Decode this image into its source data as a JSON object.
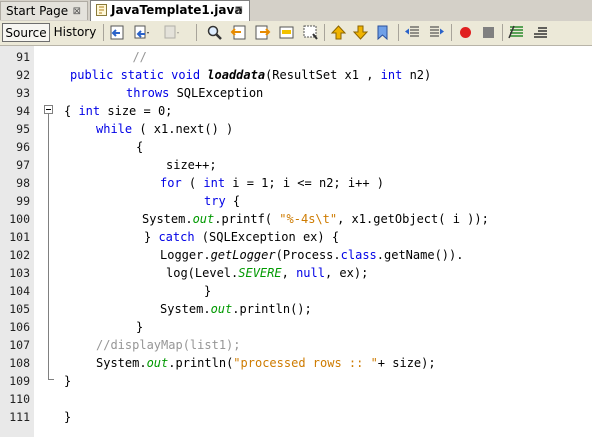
{
  "tabs": [
    {
      "label": "Start Page",
      "close": "⊠",
      "active": false
    },
    {
      "label": "JavaTemplate1.java",
      "close": "⊠",
      "active": true
    }
  ],
  "toolbar": {
    "source_label": "Source",
    "history_label": "History",
    "icons": [
      "last-edit-icon",
      "back-icon",
      "forward-icon",
      "find-icon",
      "find-previous-icon",
      "find-next-icon",
      "toggle-highlight-icon",
      "toggle-rect-select-icon",
      "previous-bookmark-icon",
      "next-bookmark-icon",
      "toggle-bookmark-icon",
      "shift-left-icon",
      "shift-right-icon",
      "start-macro-icon",
      "stop-macro-icon",
      "comment-icon",
      "uncomment-icon"
    ]
  },
  "editor": {
    "lines": [
      {
        "n": "91",
        "parts": [
          [
            "  //",
            "cmt"
          ]
        ]
      },
      {
        "n": "92",
        "parts": [
          [
            "public static void ",
            "kw"
          ],
          [
            "loaddata",
            "mth"
          ],
          [
            "(ResultSet x1 , ",
            ""
          ],
          [
            "int",
            "kw"
          ],
          [
            " n2)",
            ""
          ]
        ]
      },
      {
        "n": "93",
        "parts": [
          [
            "throws ",
            "kw"
          ],
          [
            "SQLException",
            ""
          ]
        ]
      },
      {
        "n": "94",
        "parts": [
          [
            "{ ",
            ""
          ],
          [
            "int",
            "kw"
          ],
          [
            " size = 0;",
            ""
          ]
        ]
      },
      {
        "n": "95",
        "parts": [
          [
            "while",
            "kw"
          ],
          [
            " ( x1.next() )",
            ""
          ]
        ]
      },
      {
        "n": "96",
        "parts": [
          [
            "{",
            ""
          ]
        ]
      },
      {
        "n": "97",
        "parts": [
          [
            "size++;",
            ""
          ]
        ]
      },
      {
        "n": "98",
        "parts": [
          [
            "for",
            "kw"
          ],
          [
            " ( ",
            ""
          ],
          [
            "int",
            "kw"
          ],
          [
            " i = 1; i <= n2; i++ )",
            ""
          ]
        ]
      },
      {
        "n": "99",
        "parts": [
          [
            "try",
            "kw"
          ],
          [
            " {",
            ""
          ]
        ]
      },
      {
        "n": "100",
        "parts": [
          [
            "System.",
            ""
          ],
          [
            "out",
            "fld"
          ],
          [
            ".printf( ",
            ""
          ],
          [
            "\"%-4s\\t\"",
            "str"
          ],
          [
            ", x1.getObject( i ));",
            ""
          ]
        ]
      },
      {
        "n": "101",
        "parts": [
          [
            "} ",
            ""
          ],
          [
            "catch",
            "kw"
          ],
          [
            " (SQLException ex) {",
            ""
          ]
        ]
      },
      {
        "n": "102",
        "parts": [
          [
            "Logger.",
            ""
          ],
          [
            "getLogger",
            "mth2"
          ],
          [
            "(Process.",
            ""
          ],
          [
            "class",
            "kw"
          ],
          [
            ".getName()).",
            ""
          ]
        ]
      },
      {
        "n": "103",
        "parts": [
          [
            "log(Level.",
            ""
          ],
          [
            "SEVERE",
            "fld"
          ],
          [
            ", ",
            ""
          ],
          [
            "null",
            "kw"
          ],
          [
            ", ex);",
            ""
          ]
        ]
      },
      {
        "n": "104",
        "parts": [
          [
            "}",
            ""
          ]
        ]
      },
      {
        "n": "105",
        "parts": [
          [
            "System.",
            ""
          ],
          [
            "out",
            "fld"
          ],
          [
            ".println();",
            ""
          ]
        ]
      },
      {
        "n": "106",
        "parts": [
          [
            "}",
            ""
          ]
        ]
      },
      {
        "n": "107",
        "parts": [
          [
            "//displayMap(list1);",
            "cmt"
          ]
        ]
      },
      {
        "n": "108",
        "parts": [
          [
            "System.",
            ""
          ],
          [
            "out",
            "fld"
          ],
          [
            ".println(",
            ""
          ],
          [
            "\"processed rows :: \"",
            "str"
          ],
          [
            "+ size);",
            ""
          ]
        ]
      },
      {
        "n": "109",
        "parts": [
          [
            "}",
            ""
          ]
        ]
      },
      {
        "n": "110",
        "parts": []
      },
      {
        "n": "111",
        "parts": [
          [
            "}",
            ""
          ]
        ]
      }
    ]
  },
  "colors": {
    "keyword": "#0000e6",
    "field": "#009900",
    "string": "#ce7b00",
    "comment": "#969696"
  }
}
